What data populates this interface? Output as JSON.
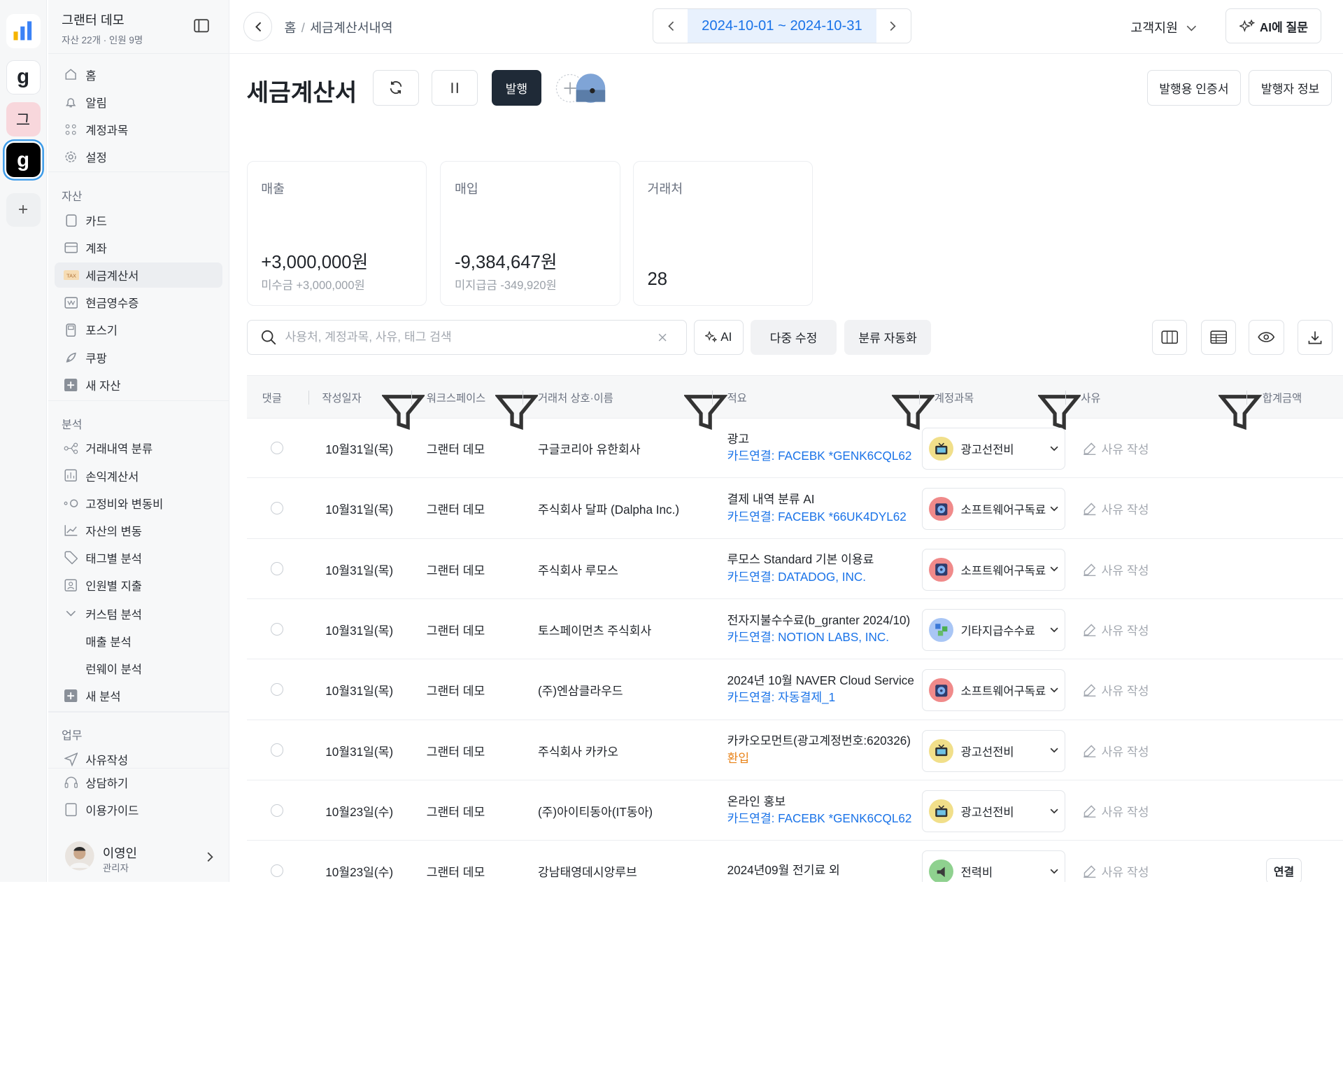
{
  "rail": {
    "workspaces": [
      {
        "label": "",
        "icon": "bar-chart-logo-icon"
      },
      {
        "label": "g",
        "icon": "granter-logo-icon"
      },
      {
        "label": "그",
        "icon": ""
      },
      {
        "label": "g",
        "icon": "granter-logo-icon"
      }
    ],
    "add": "+"
  },
  "sidebar": {
    "org_name": "그랜터 데모",
    "org_sub": "자산 22개 · 인원 9명",
    "top_items": [
      {
        "label": "홈",
        "icon": "home-icon"
      },
      {
        "label": "알림",
        "icon": "bell-icon"
      },
      {
        "label": "계정과목",
        "icon": "grid-icon"
      },
      {
        "label": "설정",
        "icon": "gear-icon"
      }
    ],
    "section_assets": "자산",
    "asset_items": [
      {
        "label": "카드",
        "icon": "card-icon"
      },
      {
        "label": "계좌",
        "icon": "bank-icon"
      },
      {
        "label": "세금계산서",
        "icon": "tax-icon"
      },
      {
        "label": "현금영수증",
        "icon": "receipt-icon"
      },
      {
        "label": "포스기",
        "icon": "pos-icon"
      },
      {
        "label": "쿠팡",
        "icon": "rocket-icon"
      },
      {
        "label": "새 자산",
        "icon": "plus-square-icon"
      }
    ],
    "section_analysis": "분석",
    "analysis_items": [
      {
        "label": "거래내역 분류",
        "icon": "flow-icon"
      },
      {
        "label": "손익계산서",
        "icon": "statement-icon"
      },
      {
        "label": "고정비와 변동비",
        "icon": "toggle-icon"
      },
      {
        "label": "자산의 변동",
        "icon": "chart-line-icon"
      },
      {
        "label": "태그별 분석",
        "icon": "tag-icon"
      },
      {
        "label": "인원별 지출",
        "icon": "person-icon"
      },
      {
        "label": "커스텀 분석",
        "icon": "chevron-down-icon"
      },
      {
        "label": "매출 분석",
        "icon": ""
      },
      {
        "label": "런웨이 분석",
        "icon": ""
      },
      {
        "label": "새 분석",
        "icon": "plus-square-icon"
      }
    ],
    "section_work": "업무",
    "work_items": [
      {
        "label": "사유작성",
        "icon": "send-icon"
      },
      {
        "label": "상담하기",
        "icon": "headset-icon"
      },
      {
        "label": "이용가이드",
        "icon": "book-icon"
      }
    ],
    "user_name": "이영인",
    "user_role": "관리자"
  },
  "header": {
    "breadcrumb_home": "홈",
    "breadcrumb_sep": "/",
    "breadcrumb_current": "세금계산서내역",
    "date_range": "2024-10-01 ~ 2024-10-31",
    "support": "고객지원",
    "ask_ai": "AI에 질문"
  },
  "main": {
    "title": "세금계산서",
    "issue_btn": "발행",
    "cert_btn": "발행용 인증서",
    "issuer_btn": "발행자 정보",
    "cards": [
      {
        "label": "매출",
        "value": "+3,000,000원",
        "sub": "미수금 +3,000,000원"
      },
      {
        "label": "매입",
        "value": "-9,384,647원",
        "sub": "미지급금 -349,920원"
      },
      {
        "label": "거래처",
        "value": "28",
        "sub": ""
      }
    ],
    "search_placeholder": "사용처, 계정과목, 사유, 태그 검색",
    "ai_btn": "AI",
    "multi_edit": "다중 수정",
    "auto_classify": "분류 자동화"
  },
  "table": {
    "headers": [
      "댓글",
      "작성일자",
      "워크스페이스",
      "거래처 상호·이름",
      "적요",
      "계정과목",
      "사유",
      "합계금액"
    ],
    "reason_label": "사유 작성",
    "link_label": "연결",
    "rows": [
      {
        "date": "10월31일(목)",
        "ws": "그랜터 데모",
        "vendor": "구글코리아 유한회사",
        "memo": "광고",
        "memo_sub": "카드연결: FACEBK *GENK6CQL62",
        "sub_color": "blue",
        "account": "광고선전비",
        "acct_icon": "tv-icon",
        "acct_color": "#f1df8a"
      },
      {
        "date": "10월31일(목)",
        "ws": "그랜터 데모",
        "vendor": "주식회사 달파 (Dalpha Inc.)",
        "memo": "결제 내역 분류 AI",
        "memo_sub": "카드연결: FACEBK *66UK4DYL62",
        "sub_color": "blue",
        "account": "소프트웨어구독료",
        "acct_icon": "disc-icon",
        "acct_color": "#f08a8a"
      },
      {
        "date": "10월31일(목)",
        "ws": "그랜터 데모",
        "vendor": "주식회사 루모스",
        "memo": "루모스 Standard 기본 이용료",
        "memo_sub": "카드연결: DATADOG, INC.",
        "sub_color": "blue",
        "account": "소프트웨어구독료",
        "acct_icon": "disc-icon",
        "acct_color": "#f08a8a"
      },
      {
        "date": "10월31일(목)",
        "ws": "그랜터 데모",
        "vendor": "토스페이먼츠 주식회사",
        "memo": "전자지불수수료(b_granter 2024/10)",
        "memo_sub": "카드연결: NOTION LABS, INC.",
        "sub_color": "blue",
        "account": "기타지급수수료",
        "acct_icon": "cubes-icon",
        "acct_color": "#a9c6f5"
      },
      {
        "date": "10월31일(목)",
        "ws": "그랜터 데모",
        "vendor": "(주)엔삼클라우드",
        "memo": "2024년 10월 NAVER Cloud Service",
        "memo_sub": "카드연결: 자동결제_1",
        "sub_color": "blue",
        "account": "소프트웨어구독료",
        "acct_icon": "disc-icon",
        "acct_color": "#f08a8a"
      },
      {
        "date": "10월31일(목)",
        "ws": "그랜터 데모",
        "vendor": "주식회사 카카오",
        "memo": "카카오모먼트(광고계정번호:620326)",
        "memo_sub": "환입",
        "sub_color": "orange",
        "account": "광고선전비",
        "acct_icon": "tv-icon",
        "acct_color": "#f1df8a"
      },
      {
        "date": "10월23일(수)",
        "ws": "그랜터 데모",
        "vendor": "(주)아이티동아(IT동아)",
        "memo": "온라인 홍보",
        "memo_sub": "카드연결: FACEBK *GENK6CQL62",
        "sub_color": "blue",
        "account": "광고선전비",
        "acct_icon": "tv-icon",
        "acct_color": "#f1df8a"
      },
      {
        "date": "10월23일(수)",
        "ws": "그랜터 데모",
        "vendor": "강남태영데시앙루브",
        "memo": "2024년09월 전기료 외",
        "memo_sub": "",
        "sub_color": "blue",
        "account": "전력비",
        "acct_icon": "plug-icon",
        "acct_color": "#8fd18f"
      }
    ]
  }
}
